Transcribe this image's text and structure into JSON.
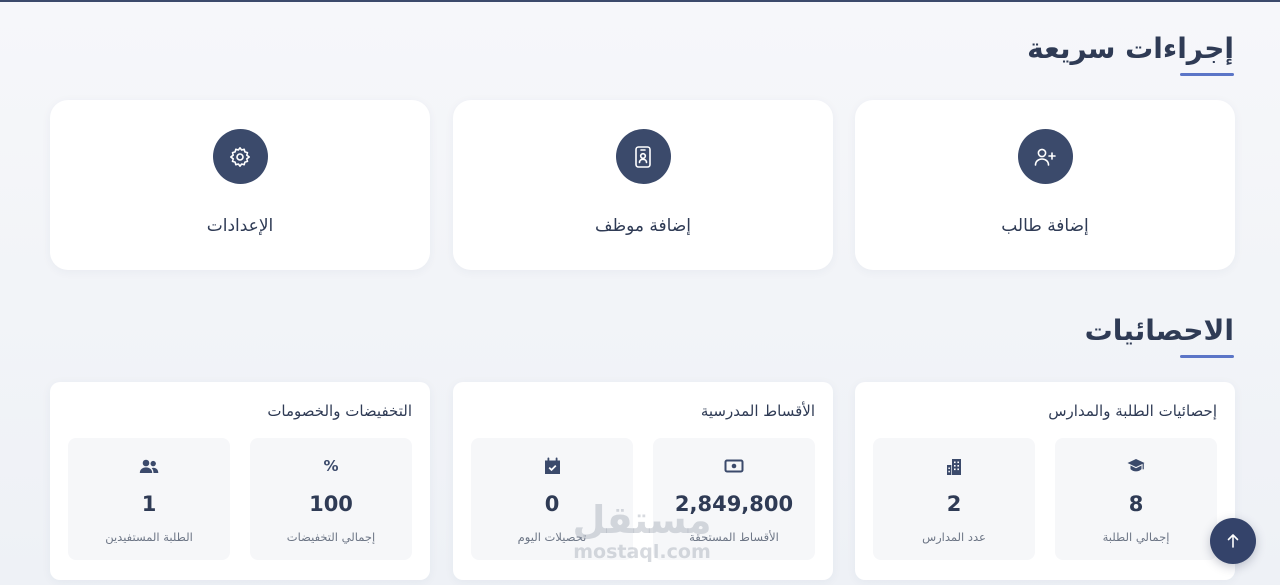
{
  "quick_actions": {
    "title": "إجراءات سريعة",
    "items": [
      {
        "label": "إضافة طالب",
        "icon": "user-plus-icon"
      },
      {
        "label": "إضافة موظف",
        "icon": "id-badge-icon"
      },
      {
        "label": "الإعدادات",
        "icon": "gear-icon"
      }
    ]
  },
  "statistics": {
    "title": "الاحصائيات",
    "panels": [
      {
        "title": "إحصائيات الطلبة والمدارس",
        "stats": [
          {
            "icon": "graduation-cap-icon",
            "value": "8",
            "label": "إجمالي الطلبة"
          },
          {
            "icon": "building-icon",
            "value": "2",
            "label": "عدد المدارس"
          }
        ]
      },
      {
        "title": "الأقساط المدرسية",
        "stats": [
          {
            "icon": "money-bill-icon",
            "value": "2,849,800",
            "label": "الأقساط المستحقة"
          },
          {
            "icon": "calendar-check-icon",
            "value": "0",
            "label": "تحصيلات اليوم"
          }
        ]
      },
      {
        "title": "التخفيضات والخصومات",
        "stats": [
          {
            "icon": "percent-icon",
            "value": "100",
            "label": "إجمالي التخفيضات",
            "glyph": "%"
          },
          {
            "icon": "users-icon",
            "value": "1",
            "label": "الطلبة المستفيدين"
          }
        ]
      }
    ]
  },
  "watermark": {
    "arabic": "مستقل",
    "latin": "mostaql.com"
  },
  "colors": {
    "primary": "#3b4a6b",
    "accent": "#5b75c7",
    "card_bg": "#ffffff",
    "stat_box_bg": "#f6f7f9"
  }
}
